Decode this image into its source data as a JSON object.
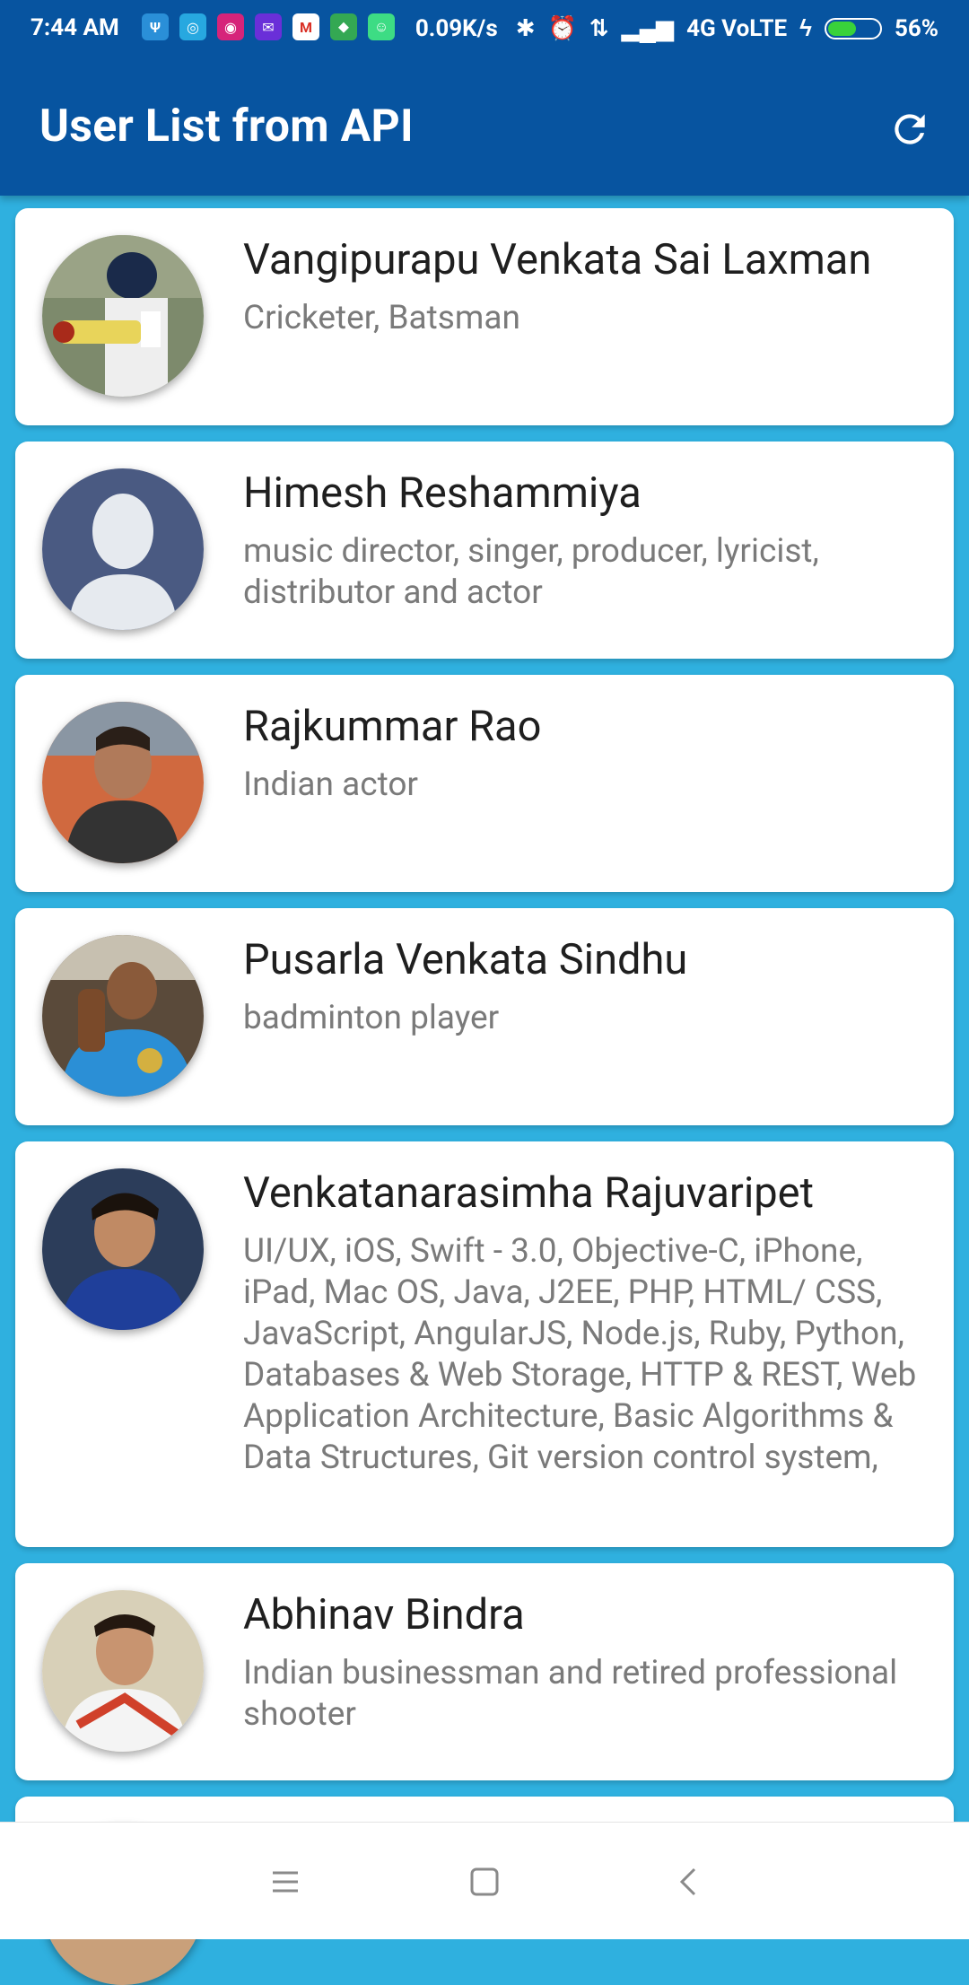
{
  "status_bar": {
    "time": "7:44 AM",
    "net_speed": "0.09K/s",
    "network": "4G VoLTE",
    "battery": "56%",
    "battery_level": 0.56
  },
  "app_bar": {
    "title": "User List from API",
    "refresh_icon": "refresh-icon"
  },
  "users": [
    {
      "name": "Vangipurapu Venkata Sai Laxman",
      "description": "Cricketer, Batsman"
    },
    {
      "name": "Himesh Reshammiya",
      "description": "music director, singer, producer, lyricist, distributor and actor"
    },
    {
      "name": "Rajkummar Rao",
      "description": "Indian actor"
    },
    {
      "name": "Pusarla Venkata Sindhu",
      "description": "badminton player"
    },
    {
      "name": "Venkatanarasimha Rajuvaripet",
      "description": "UI/UX, iOS, Swift - 3.0, Objective-C, iPhone, iPad, Mac OS, Java, J2EE, PHP, HTML/ CSS, JavaScript, AngularJS, Node.js, Ruby, Python, Databases & Web Storage, HTTP & REST, Web Application Architecture, Basic Algorithms & Data Structures, Git version control system,"
    },
    {
      "name": "Abhinav Bindra",
      "description": "Indian businessman and retired professional shooter"
    }
  ],
  "navigation": {
    "menu_icon": "menu-icon",
    "home_icon": "home-icon",
    "back_icon": "back-icon"
  },
  "colors": {
    "app_bar": "#0754a0",
    "background": "#2fb0df"
  }
}
